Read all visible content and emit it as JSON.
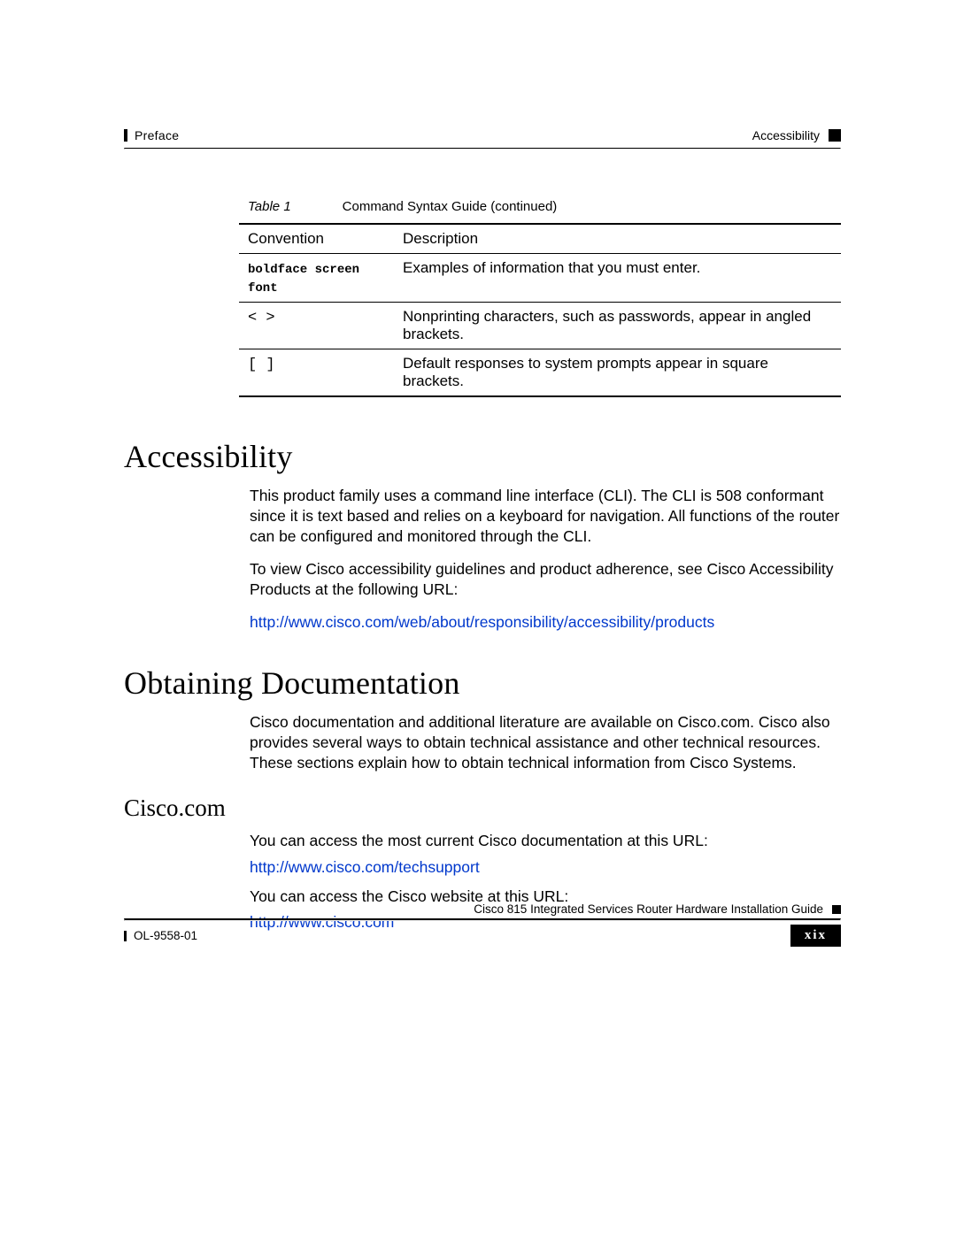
{
  "header": {
    "left": "Preface",
    "right": "Accessibility"
  },
  "table": {
    "caption_label": "Table 1",
    "caption_text": "Command Syntax Guide (continued)",
    "headers": {
      "c1": "Convention",
      "c2": "Description"
    },
    "rows": [
      {
        "conv": "boldface screen font",
        "desc": "Examples of information that you must enter."
      },
      {
        "conv": "<     >",
        "desc": "Nonprinting characters, such as passwords, appear in angled brackets."
      },
      {
        "conv": "[     ]",
        "desc": "Default responses to system prompts appear in square brackets."
      }
    ]
  },
  "sections": {
    "accessibility": {
      "title": "Accessibility",
      "p1": "This product family uses a command line interface (CLI). The CLI is 508 conformant since it is text based and relies on a keyboard for navigation. All functions of the router can be configured and monitored through the CLI.",
      "p2": "To view Cisco accessibility guidelines and product adherence, see Cisco Accessibility Products at the following URL:",
      "link": "http://www.cisco.com/web/about/responsibility/accessibility/products"
    },
    "obtaining": {
      "title": "Obtaining Documentation",
      "p1": "Cisco documentation and additional literature are available on Cisco.com. Cisco also provides several ways to obtain technical assistance and other technical resources. These sections explain how to obtain technical information from Cisco Systems."
    },
    "cisco_com": {
      "title": "Cisco.com",
      "p1": "You can access the most current Cisco documentation at this URL:",
      "link1": "http://www.cisco.com/techsupport",
      "p2": "You can access the Cisco website at this URL:",
      "link2": "http://www.cisco.com"
    }
  },
  "footer": {
    "doc_title": "Cisco 815 Integrated Services Router Hardware Installation Guide",
    "doc_id": "OL-9558-01",
    "page_num": "xix"
  }
}
